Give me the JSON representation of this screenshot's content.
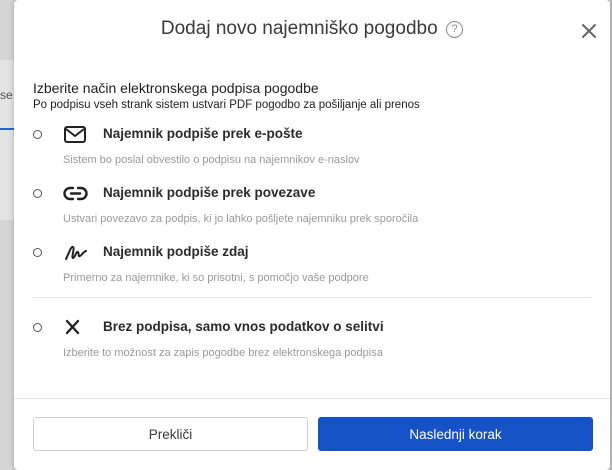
{
  "background": {
    "partial_text": "se"
  },
  "modal": {
    "title": "Dodaj novo najemniško pogodbo",
    "help_symbol": "?",
    "intro_title": "Izberite način elektronskega podpisa pogodbe",
    "intro_subtitle": "Po podpisu vseh strank sistem ustvari PDF pogodbo za pošiljanje ali prenos"
  },
  "options": [
    {
      "icon": "envelope-icon",
      "label": "Najemnik podpiše prek e-pošte",
      "description": "Sistem bo poslal obvestilo o podpisu na najemnikov e-naslov"
    },
    {
      "icon": "link-icon",
      "label": "Najemnik podpiše prek povezave",
      "description": "Ustvari povezavo za podpis, ki jo lahko pošljete najemniku prek sporočila"
    },
    {
      "icon": "signature-icon",
      "label": "Najemnik podpiše zdaj",
      "description": "Primerno za najemnike, ki so prisotni, s pomočjo vaše podpore"
    },
    {
      "icon": "x-icon",
      "label": "Brez podpisa, samo vnos podatkov o selitvi",
      "description": "Izberite to možnost za zapis pogodbe brez elektronskega podpisa"
    }
  ],
  "footer": {
    "cancel_label": "Prekliči",
    "next_label": "Naslednji korak"
  },
  "colors": {
    "primary": "#1552c8",
    "text": "#2b2b2b",
    "muted": "#9a9a9a"
  }
}
